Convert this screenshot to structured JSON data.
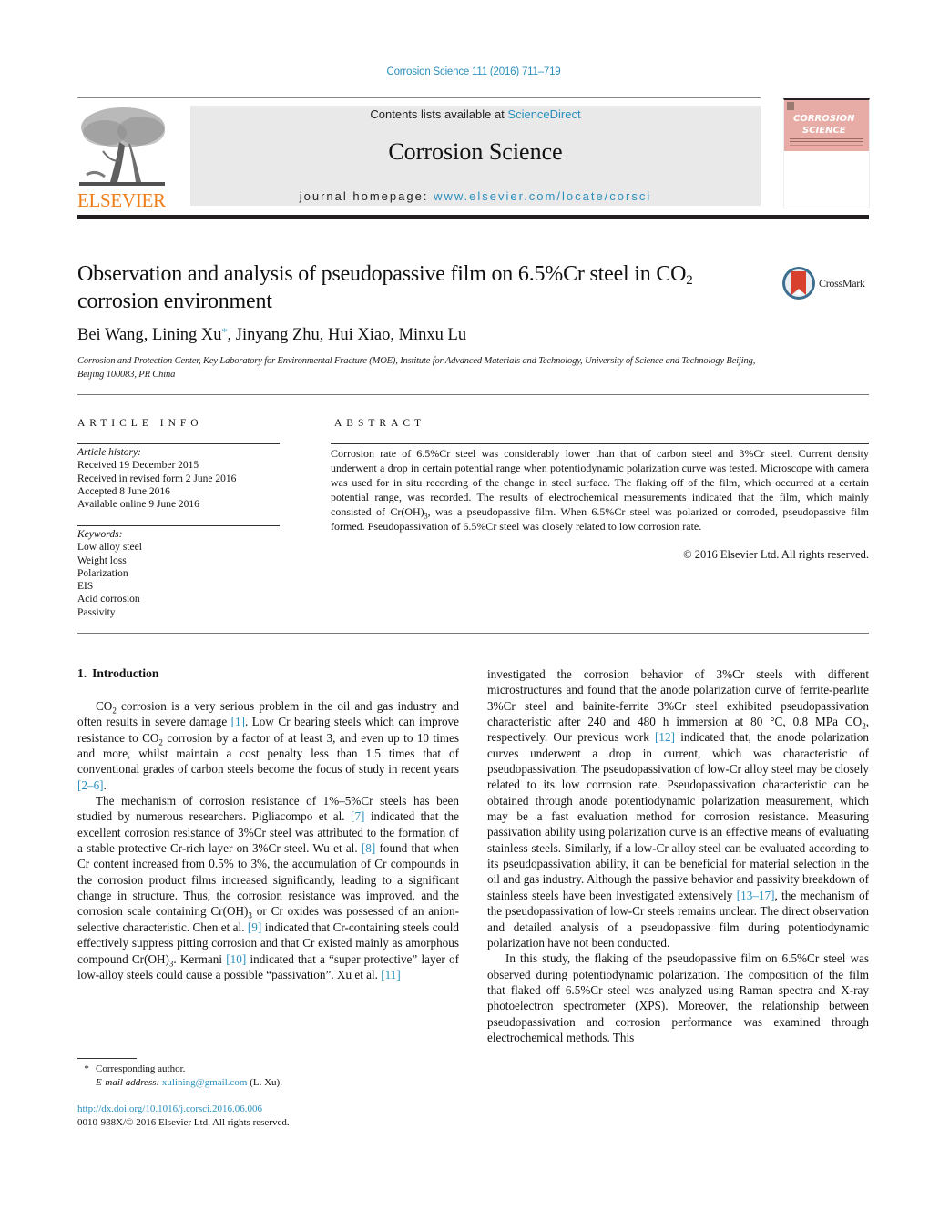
{
  "header": {
    "citation": "Corrosion Science 111 (2016) 711–719",
    "publisher_logo_text": "ELSEVIER",
    "contents_prefix": "Contents lists available at ",
    "contents_link": "ScienceDirect",
    "journal_name": "Corrosion Science",
    "homepage_prefix": "journal homepage: ",
    "homepage_link": "www.elsevier.com/locate/corsci",
    "cover_title_line1": "CORROSION",
    "cover_title_line2": "SCIENCE"
  },
  "article": {
    "title_part1": "Observation and analysis of pseudopassive film on 6.5%Cr steel in CO",
    "title_sub": "2",
    "title_part2": "corrosion environment",
    "crossmark_label": "CrossMark",
    "authors": [
      {
        "name": "Bei Wang",
        "corresponding": false
      },
      {
        "name": "Lining Xu",
        "corresponding": true
      },
      {
        "name": "Jinyang Zhu",
        "corresponding": false
      },
      {
        "name": "Hui Xiao",
        "corresponding": false
      },
      {
        "name": "Minxu Lu",
        "corresponding": false
      }
    ],
    "author_sep": ", ",
    "corresponding_mark": "*",
    "affiliation": "Corrosion and Protection Center, Key Laboratory for Environmental Fracture (MOE), Institute for Advanced Materials and Technology, University of Science and Technology Beijing, Beijing 100083, PR China"
  },
  "article_info": {
    "heading": "ARTICLE INFO",
    "history_label": "Article history:",
    "history": [
      "Received 19 December 2015",
      "Received in revised form 2 June 2016",
      "Accepted 8 June 2016",
      "Available online 9 June 2016"
    ],
    "keywords_label": "Keywords:",
    "keywords": [
      "Low alloy steel",
      "Weight loss",
      "Polarization",
      "EIS",
      "Acid corrosion",
      "Passivity"
    ]
  },
  "abstract": {
    "heading": "ABSTRACT",
    "text_a": "Corrosion rate of 6.5%Cr steel was considerably lower than that of carbon steel and 3%Cr steel. Current density underwent a drop in certain potential range when potentiodynamic polarization curve was tested. Microscope with camera was used for in situ recording of the change in steel surface. The flaking off of the film, which occurred at a certain potential range, was recorded. The results of electrochemical measurements indicated that the film, which mainly consisted of Cr(OH)",
    "text_sub": "3",
    "text_b": ", was a pseudopassive film. When 6.5%Cr steel was polarized or corroded, pseudopassive film formed. Pseudopassivation of 6.5%Cr steel was closely related to low corrosion rate.",
    "copyright": "© 2016 Elsevier Ltd. All rights reserved."
  },
  "body": {
    "section_number": "1.",
    "section_title": "Introduction",
    "p1": {
      "a": "CO",
      "a_sub": "2",
      "b": " corrosion is a very serious problem in the oil and gas industry and often results in severe damage ",
      "ref1": "[1]",
      "c": ". Low Cr bearing steels which can improve resistance to CO",
      "c_sub": "2",
      "d": " corrosion by a factor of at least 3, and even up to 10 times and more, whilst maintain a cost penalty less than 1.5 times that of conventional grades of carbon steels become the focus of study in recent years ",
      "ref2": "[2–6]",
      "e": "."
    },
    "p2": {
      "a": "The mechanism of corrosion resistance of 1%–5%Cr steels has been studied by numerous researchers. Pigliacompo et al. ",
      "ref7": "[7]",
      "b": " indicated that the excellent corrosion resistance of 3%Cr steel was attributed to the formation of a stable protective Cr-rich layer on 3%Cr steel. Wu et al. ",
      "ref8": "[8]",
      "c": " found that when Cr content increased from 0.5% to 3%, the accumulation of Cr compounds in the corrosion product films increased significantly, leading to a significant change in structure. Thus, the corrosion resistance was improved, and the corrosion scale containing Cr(OH)",
      "c_sub": "3",
      "d": " or Cr oxides was possessed of an anion-selective characteristic. Chen et al. ",
      "ref9": "[9]",
      "e": " indicated that Cr-containing steels could effectively suppress pitting corrosion and that Cr existed mainly as amorphous compound Cr(OH)",
      "e_sub": "3",
      "f": ". Kermani ",
      "ref10": "[10]",
      "g": " indicated that a “super protective” layer of low-alloy steels could cause a possible “passivation”. Xu et al. ",
      "ref11": "[11]",
      "h": " investigated the corrosion behavior of 3%Cr steels with different microstructures and found that the anode polarization curve of ferrite-pearlite 3%Cr steel and bainite-ferrite 3%Cr steel exhibited pseudopassivation characteristic after 240 and 480 h immersion at 80 °C, 0.8 MPa CO",
      "h_sub": "2",
      "i": ", respectively. Our previous work ",
      "ref12": "[12]",
      "j": " indicated that, the anode polarization curves underwent a drop in current, which was characteristic of pseudopassivation. The pseudopassivation of low-Cr alloy steel may be closely related to its low corrosion rate. Pseudopassivation characteristic can be obtained through anode potentiodynamic polarization measurement, which may be a fast evaluation method for corrosion resistance. Measuring passivation ability using polarization curve is an effective means of evaluating stainless steels. Similarly, if a low-Cr alloy steel can be evaluated according to its pseudopassivation ability, it can be beneficial for material selection in the oil and gas industry. Although the passive behavior and passivity breakdown of stainless steels have been investigated extensively ",
      "ref13": "[13–17]",
      "k": ", the mechanism of the pseudopassivation of low-Cr steels remains unclear. The direct observation and detailed analysis of a pseudopassive film during potentiodynamic polarization have not been conducted."
    },
    "p3": "In this study, the flaking of the pseudopassive film on 6.5%Cr steel was observed during potentiodynamic polarization. The composition of the film that flaked off 6.5%Cr steel was analyzed using Raman spectra and X-ray photoelectron spectrometer (XPS). Moreover, the relationship between pseudopassivation and corrosion performance was examined through electrochemical methods. This"
  },
  "footnotes": {
    "mark": "*",
    "corresponding": "Corresponding author.",
    "email_label": "E-mail address:",
    "email": "xulining@gmail.com",
    "email_suffix": " (L. Xu).",
    "doi": "http://dx.doi.org/10.1016/j.corsci.2016.06.006",
    "issn_copyright": "0010-938X/© 2016 Elsevier Ltd. All rights reserved."
  },
  "colors": {
    "link": "#2a8fbd",
    "elsevier_orange": "#f07d18",
    "journal_box_bg": "#e9e9e9",
    "cover_pink": "#e8aca6",
    "rule_dark": "#231f20"
  }
}
